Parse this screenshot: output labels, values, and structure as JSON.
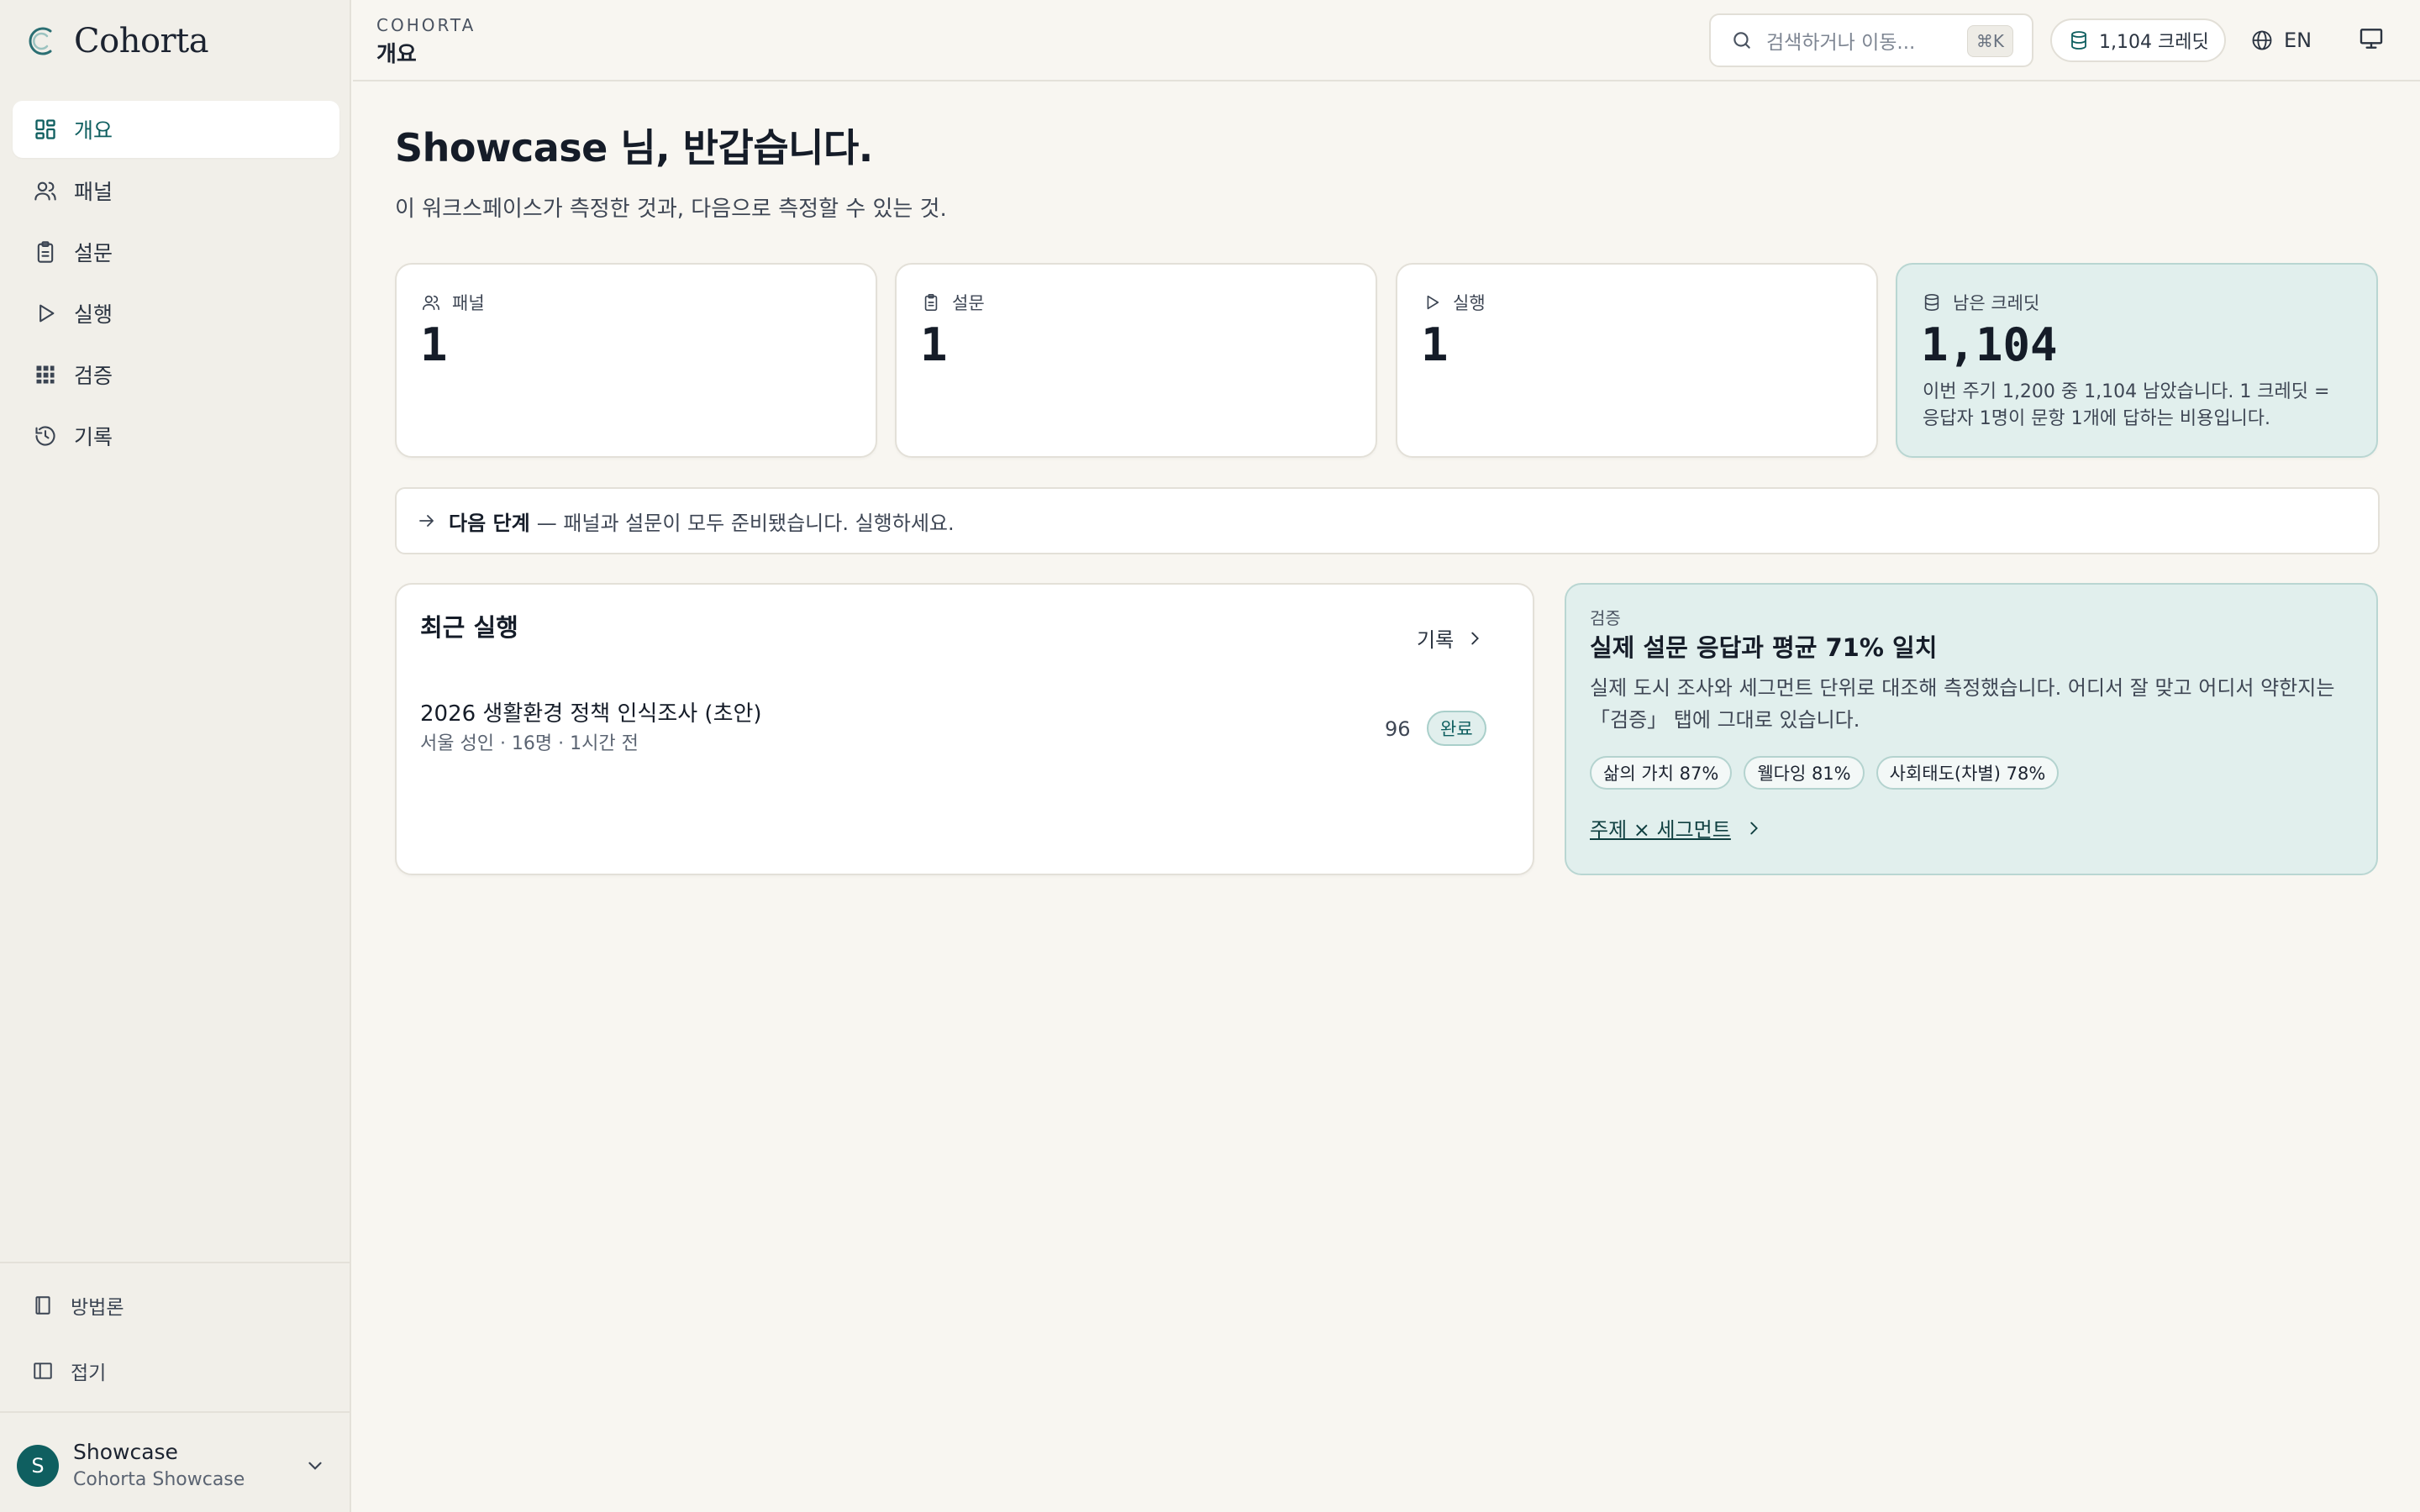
{
  "app": {
    "brand": "Cohorta"
  },
  "sidebar": {
    "items": [
      {
        "label": "개요",
        "icon": "dashboard-icon",
        "active": true
      },
      {
        "label": "패널",
        "icon": "users-icon"
      },
      {
        "label": "설문",
        "icon": "clipboard-icon"
      },
      {
        "label": "실행",
        "icon": "play-icon"
      },
      {
        "label": "검증",
        "icon": "grid-icon"
      },
      {
        "label": "기록",
        "icon": "history-icon"
      }
    ],
    "methodology": "방법론",
    "collapse": "접기",
    "user": {
      "initial": "S",
      "name": "Showcase",
      "org": "Cohorta Showcase"
    }
  },
  "header": {
    "crumb_top": "COHORTA",
    "crumb_title": "개요",
    "search_placeholder": "검색하거나 이동...",
    "shortcut": "⌘K",
    "credits": "1,104 크레딧",
    "language": "EN"
  },
  "main": {
    "greeting": "Showcase 님, 반갑습니다.",
    "subtitle": "이 워크스페이스가 측정한 것과, 다음으로 측정할 수 있는 것.",
    "stats": [
      {
        "label": "패널",
        "value": "1",
        "icon": "users-icon"
      },
      {
        "label": "설문",
        "value": "1",
        "icon": "clipboard-icon"
      },
      {
        "label": "실행",
        "value": "1",
        "icon": "play-icon"
      }
    ],
    "credit_card": {
      "label": "남은 크레딧",
      "value": "1,104",
      "desc": "이번 주기 1,200 중 1,104 남았습니다. 1 크레딧 = 응답자 1명이 문항 1개에 답하는 비용입니다."
    },
    "next_step": {
      "strong": "다음 단계",
      "text": "— 패널과 설문이 모두 준비됐습니다. 실행하세요."
    },
    "recent_runs": {
      "title": "최근 실행",
      "link": "기록",
      "rows": [
        {
          "title": "2026 생활환경 정책 인식조사 (초안)",
          "meta": "서울 성인 · 16명 · 1시간 전",
          "score": "96",
          "status": "완료"
        }
      ]
    },
    "validation": {
      "eyebrow": "검증",
      "title": "실제 설문 응답과 평균 71% 일치",
      "desc": "실제 도시 조사와 세그먼트 단위로 대조해 측정했습니다. 어디서 잘 맞고 어디서 약한지는 「검증」 탭에 그대로 있습니다.",
      "tags": [
        "삶의 가치 87%",
        "웰다잉 81%",
        "사회태도(차별) 78%"
      ],
      "link": "주제 × 세그먼트"
    }
  },
  "colors": {
    "accent": "#0f5f60",
    "accent_soft": "#e1efed",
    "background": "#f8f6f1"
  }
}
